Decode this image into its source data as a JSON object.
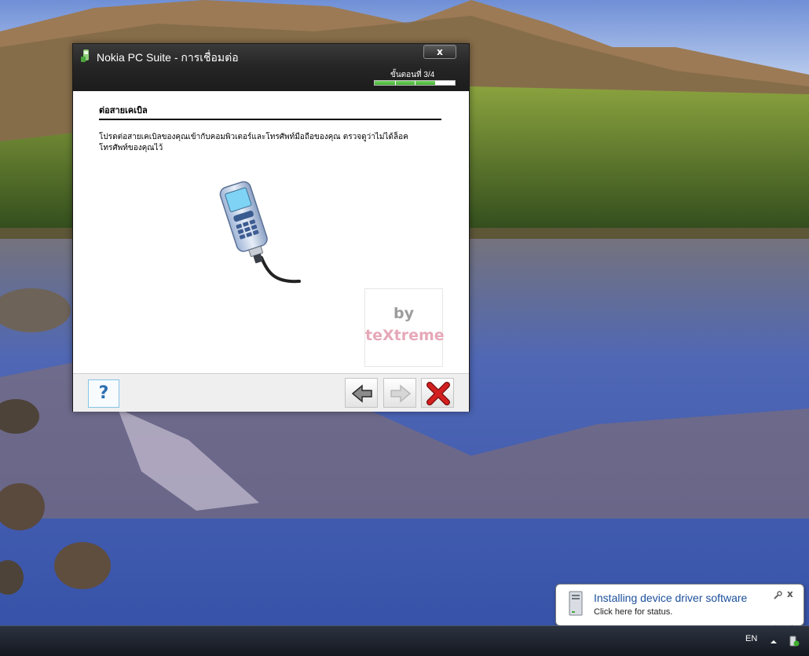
{
  "dialog": {
    "title": "Nokia PC Suite - การเชื่อมต่อ",
    "close_label": "x",
    "step_label": "ขั้นตอนที่ 3/4",
    "progress": 0.75,
    "heading": "ต่อสายเคเบิล",
    "instruction": "โปรดต่อสายเคเบิลของคุณเข้ากับคอมพิวเตอร์และโทรศัพท์มือถือของคุณ ตรวจดูว่าไม่ได้ล็อคโทรศัพท์ของคุณไว้",
    "watermark": {
      "by": "by",
      "brand": "teXtreme"
    },
    "footer": {
      "help_label": "?",
      "back_icon": "back-arrow-icon",
      "next_icon": "next-arrow-icon",
      "cancel_icon": "cancel-x-icon"
    }
  },
  "balloon": {
    "title": "Installing device driver software",
    "subtitle": "Click here for status.",
    "close_label": "x"
  },
  "taskbar": {
    "language": "EN"
  },
  "colors": {
    "accent": "#3fae2f",
    "balloon_title": "#1c4f9c",
    "cancel_red": "#d21f1f"
  }
}
